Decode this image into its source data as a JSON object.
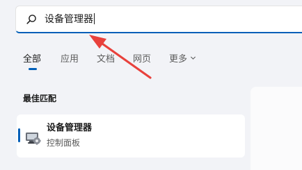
{
  "search": {
    "value": "设备管理器",
    "icon": "search-icon"
  },
  "tabs": [
    {
      "label": "全部",
      "active": true
    },
    {
      "label": "应用",
      "active": false
    },
    {
      "label": "文档",
      "active": false
    },
    {
      "label": "网页",
      "active": false
    },
    {
      "label": "更多",
      "active": false
    }
  ],
  "best_match": {
    "section_title": "最佳匹配",
    "item": {
      "name": "设备管理器",
      "subtitle": "控制面板",
      "icon": "device-manager-icon"
    }
  },
  "colors": {
    "accent": "#005fb8",
    "background": "#f2f3f7",
    "annotation_arrow": "#e8413c"
  }
}
